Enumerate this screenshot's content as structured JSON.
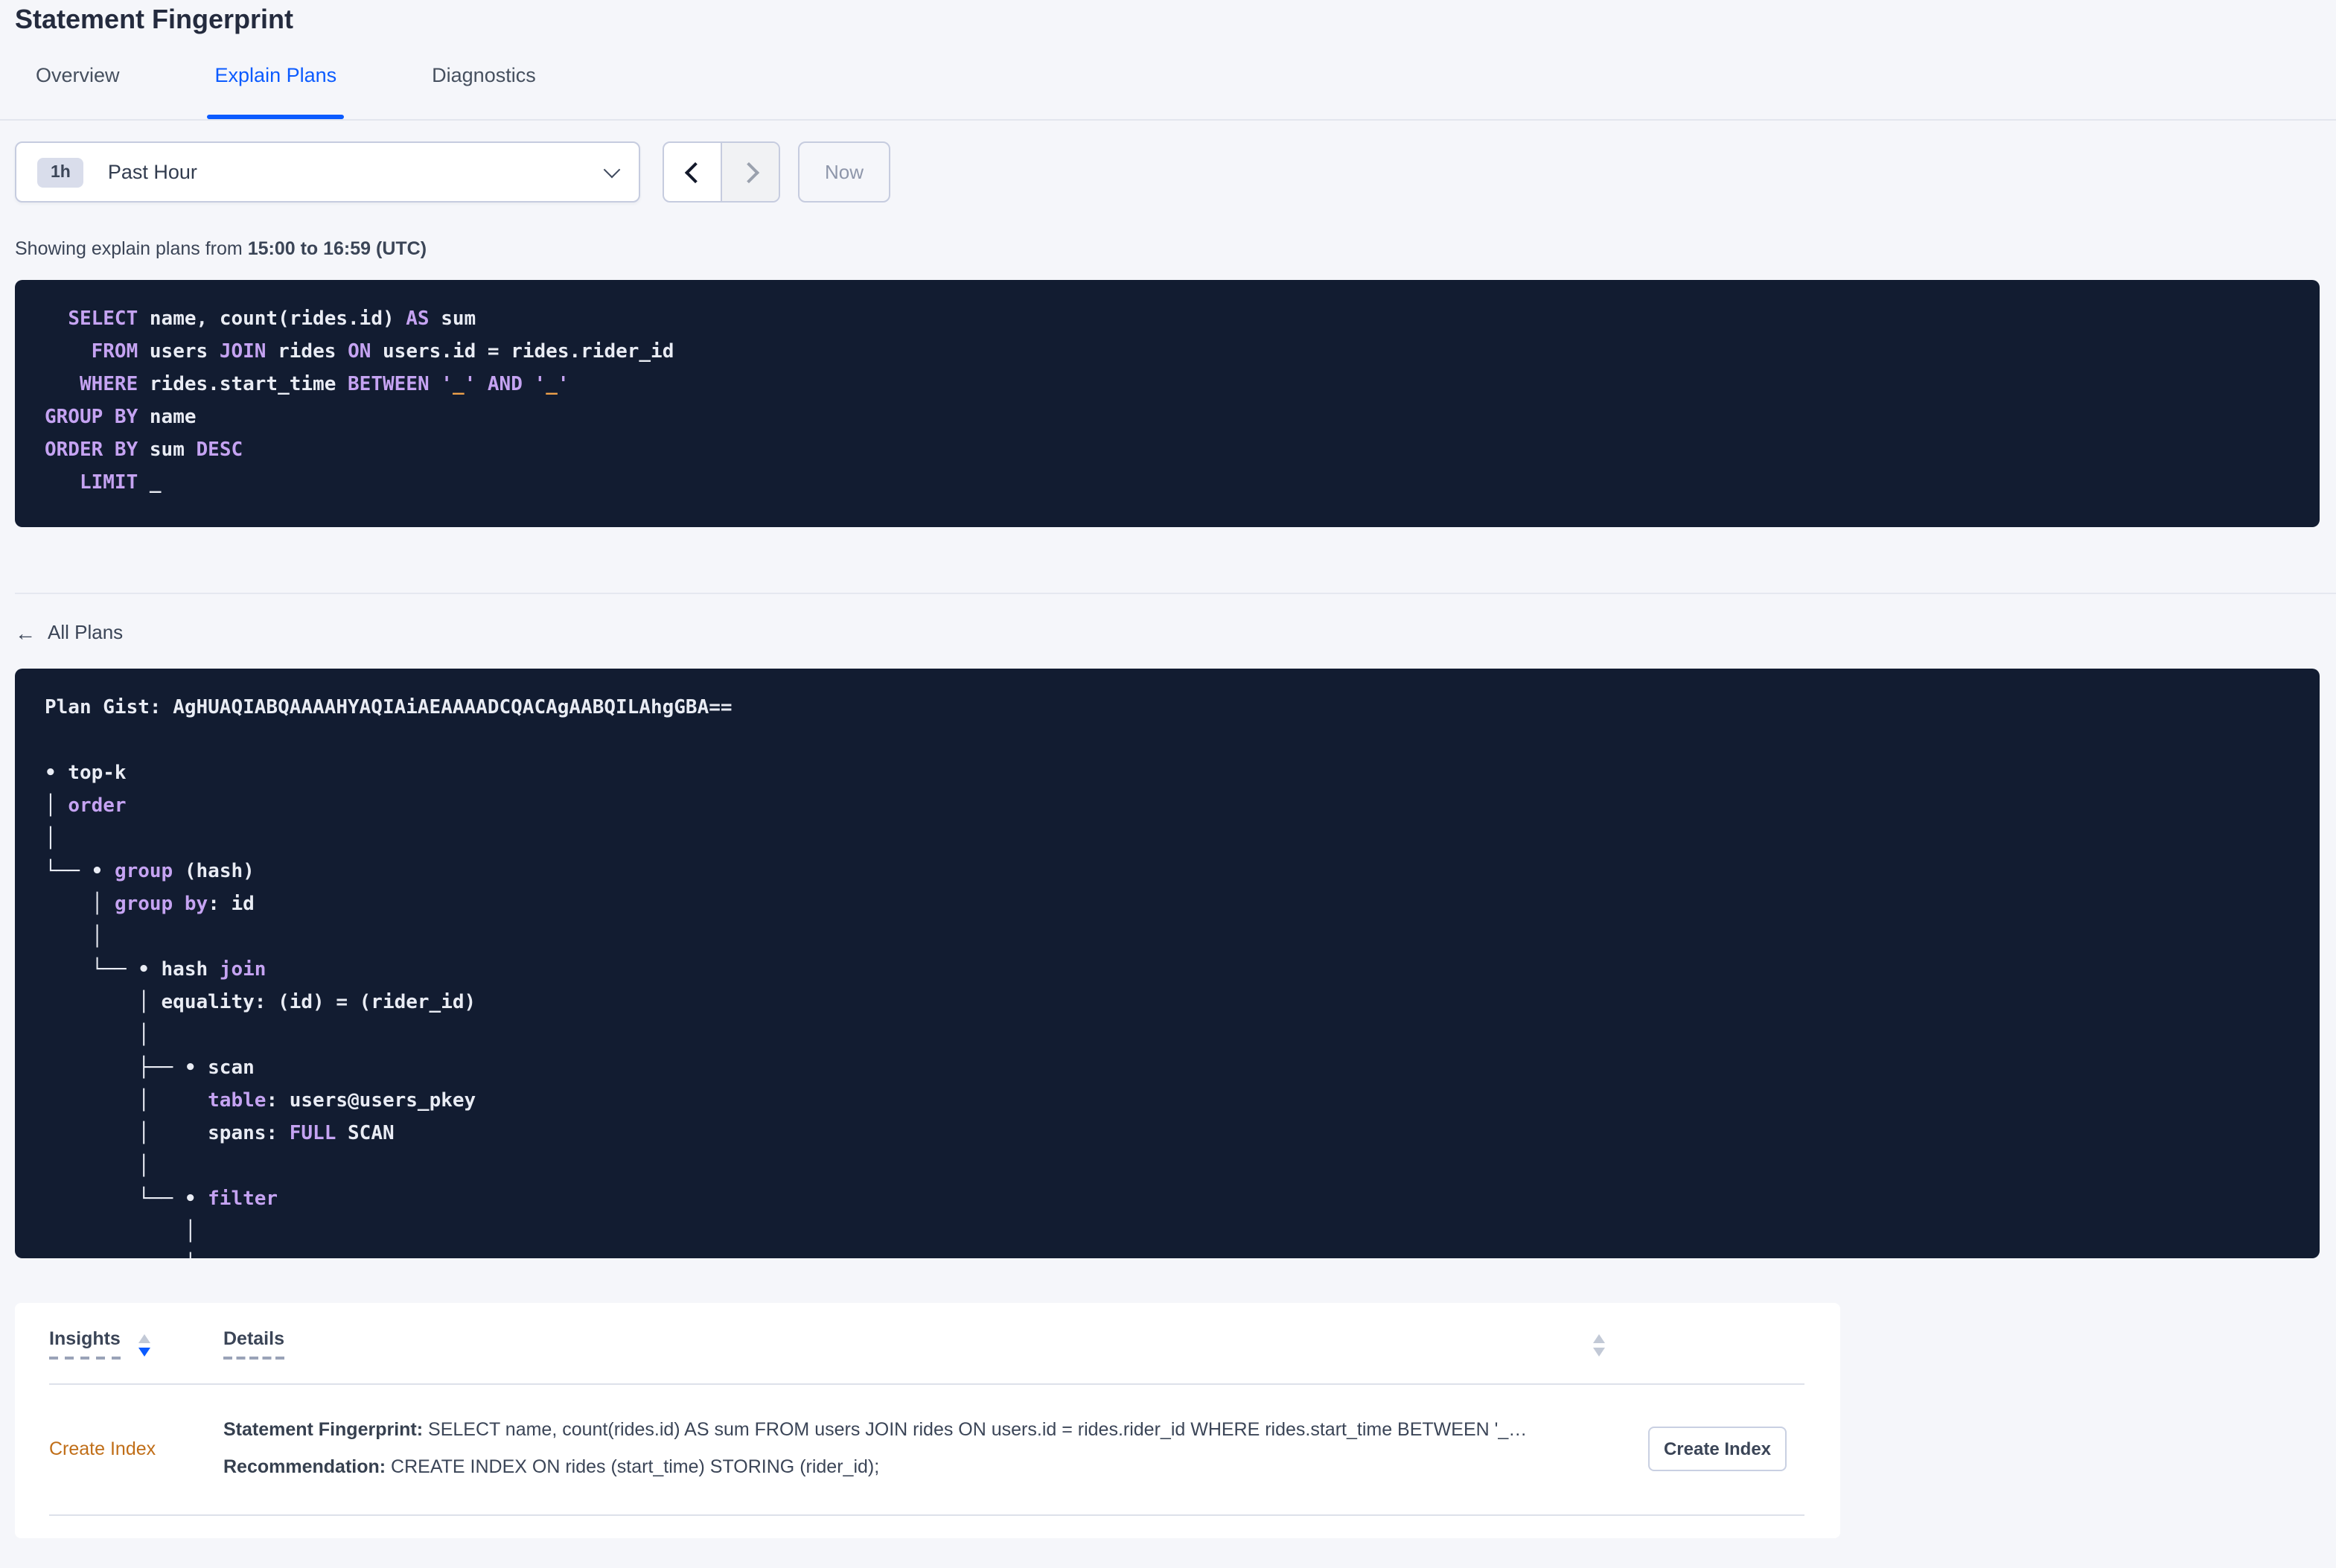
{
  "page": {
    "title": "Statement Fingerprint"
  },
  "colors": {
    "accent_blue": "#0b5bff",
    "code_background": "#121c31",
    "code_keyword": "#c5a3f2",
    "code_literal": "#eda04a",
    "insight_orange": "#c06e18",
    "page_background": "#f5f6fa"
  },
  "tabs": [
    {
      "label": "Overview"
    },
    {
      "label": "Explain Plans"
    },
    {
      "label": "Diagnostics"
    }
  ],
  "time_picker": {
    "badge": "1h",
    "label": "Past Hour",
    "now_label": "Now"
  },
  "summary": {
    "prefix": "Showing explain plans from ",
    "range": "15:00 to 16:59 (UTC)"
  },
  "sql_block": {
    "lines": [
      [
        [
          "pl",
          "  "
        ],
        [
          "kw",
          "SELECT"
        ],
        [
          "pl",
          " name, count(rides.id) "
        ],
        [
          "kw",
          "AS"
        ],
        [
          "pl",
          " sum"
        ]
      ],
      [
        [
          "pl",
          "    "
        ],
        [
          "kw",
          "FROM"
        ],
        [
          "pl",
          " users "
        ],
        [
          "kw",
          "JOIN"
        ],
        [
          "pl",
          " rides "
        ],
        [
          "kw",
          "ON"
        ],
        [
          "pl",
          " users.id = rides.rider_id"
        ]
      ],
      [
        [
          "pl",
          "   "
        ],
        [
          "kw",
          "WHERE"
        ],
        [
          "pl",
          " rides.start_time "
        ],
        [
          "kw",
          "BETWEEN"
        ],
        [
          "pl",
          " "
        ],
        [
          "kw",
          "'"
        ],
        [
          "num",
          "_"
        ],
        [
          "kw",
          "'"
        ],
        [
          "pl",
          " "
        ],
        [
          "kw",
          "AND"
        ],
        [
          "pl",
          " "
        ],
        [
          "kw",
          "'"
        ],
        [
          "num",
          "_"
        ],
        [
          "kw",
          "'"
        ]
      ],
      [
        [
          "kw",
          "GROUP BY"
        ],
        [
          "pl",
          " name"
        ]
      ],
      [
        [
          "kw",
          "ORDER BY"
        ],
        [
          "pl",
          " sum "
        ],
        [
          "kw",
          "DESC"
        ]
      ],
      [
        [
          "pl",
          "   "
        ],
        [
          "kw",
          "LIMIT"
        ],
        [
          "pl",
          " _"
        ]
      ]
    ]
  },
  "back_link": {
    "label": "All Plans"
  },
  "gist_block": {
    "lines": [
      [
        [
          "bold",
          "Plan Gist: "
        ],
        [
          "pl",
          "AgHUAQIABQAAAAHYAQIAiAEAAAADCQACAgAABQILAhgGBA=="
        ]
      ],
      [],
      [
        [
          "pl",
          "• top-k"
        ]
      ],
      [
        [
          "pl",
          "│ "
        ],
        [
          "kw",
          "order"
        ]
      ],
      [
        [
          "pl",
          "│"
        ]
      ],
      [
        [
          "pl",
          "└── • "
        ],
        [
          "kw",
          "group"
        ],
        [
          "pl",
          " (hash)"
        ]
      ],
      [
        [
          "pl",
          "    │ "
        ],
        [
          "kw",
          "group by"
        ],
        [
          "pl",
          ": id"
        ]
      ],
      [
        [
          "pl",
          "    │"
        ]
      ],
      [
        [
          "pl",
          "    └── • hash "
        ],
        [
          "kw",
          "join"
        ]
      ],
      [
        [
          "pl",
          "        │ equality: (id) = (rider_id)"
        ]
      ],
      [
        [
          "pl",
          "        │"
        ]
      ],
      [
        [
          "pl",
          "        ├── • scan"
        ]
      ],
      [
        [
          "pl",
          "        │     "
        ],
        [
          "kw",
          "table"
        ],
        [
          "pl",
          ": users@users_pkey"
        ]
      ],
      [
        [
          "pl",
          "        │     spans: "
        ],
        [
          "kw",
          "FULL"
        ],
        [
          "pl",
          " SCAN"
        ]
      ],
      [
        [
          "pl",
          "        │"
        ]
      ],
      [
        [
          "pl",
          "        └── • "
        ],
        [
          "kw",
          "filter"
        ]
      ],
      [
        [
          "pl",
          "            │"
        ]
      ],
      [
        [
          "pl",
          "            │"
        ]
      ]
    ]
  },
  "insights_table": {
    "columns": [
      {
        "label": "Insights"
      },
      {
        "label": "Details"
      }
    ],
    "row": {
      "insight": "Create Index",
      "detail1_label": "Statement Fingerprint:",
      "detail1_text": " SELECT name, count(rides.id) AS sum FROM users JOIN rides ON users.id = rides.rider_id WHERE rides.start_time BETWEEN '_…",
      "detail2_label": "Recommendation:",
      "detail2_text": " CREATE INDEX ON rides (start_time) STORING (rider_id);",
      "action": "Create Index"
    }
  }
}
